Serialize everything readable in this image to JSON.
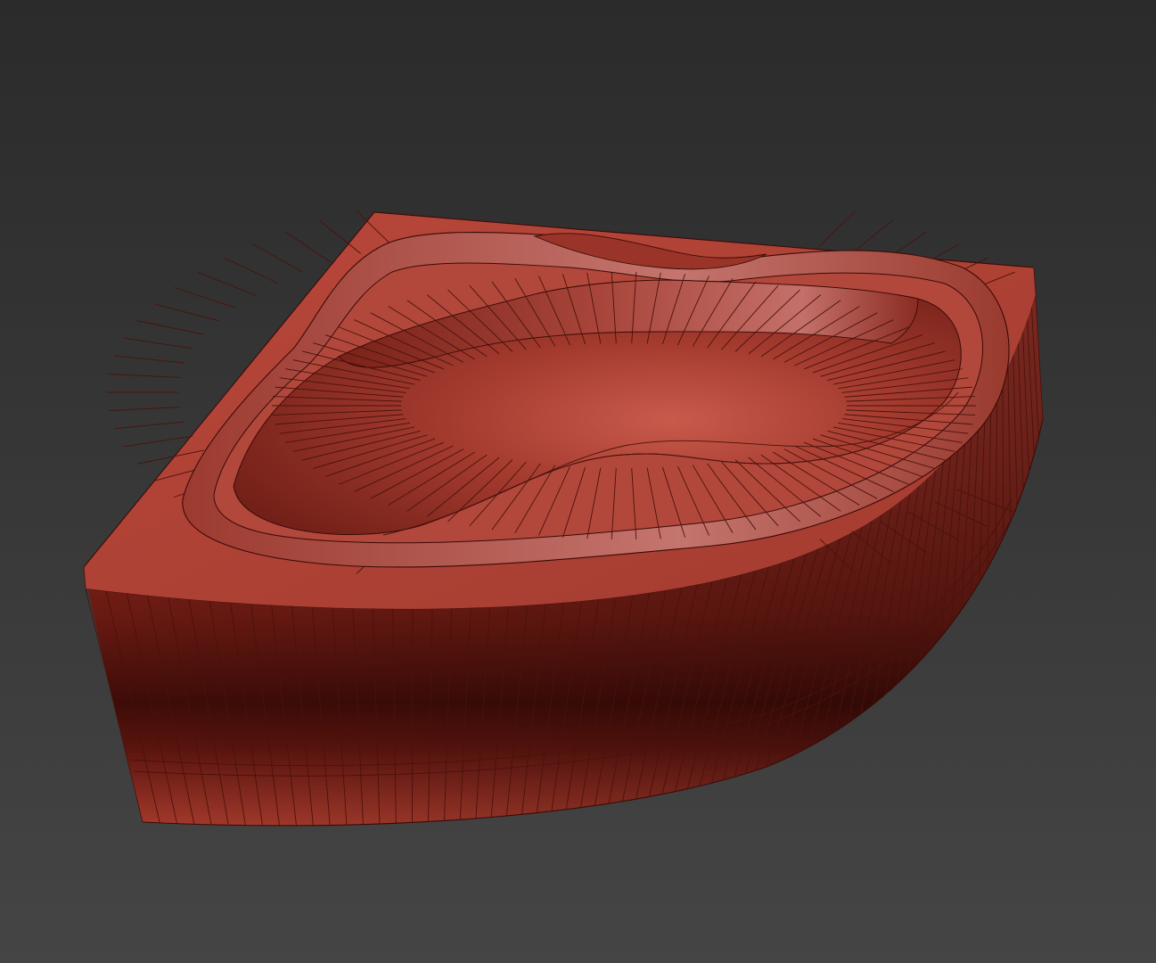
{
  "scene": {
    "background_top": "#2b2b2b",
    "background_bottom": "#454545",
    "object": "corner-bathtub",
    "display_mode": "wireframe-on-shaded",
    "material_color": "#b0483a",
    "wire_color": "#3a0a06"
  }
}
